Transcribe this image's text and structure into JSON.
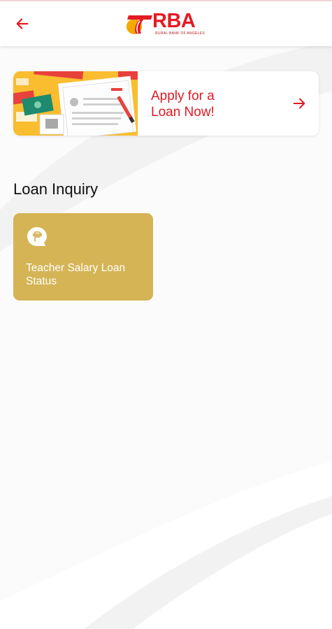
{
  "header": {
    "back_icon": "arrow-left-icon",
    "logo_text": "RBA",
    "logo_subtext": "RURAL BANK OF ANGELES",
    "accent_color": "#e31b23",
    "logo_mark_color": "#f5a800"
  },
  "apply_banner": {
    "line1": "Apply for a",
    "line2": "Loan Now!",
    "arrow_icon": "arrow-right-icon",
    "text_color": "#e01b24",
    "illustration_bg": "#f9bd2f"
  },
  "loan_inquiry": {
    "title": "Loan Inquiry",
    "tiles": [
      {
        "icon": "peso-chat-icon",
        "label_line1": "Teacher Salary Loan",
        "label_line2": "Status",
        "color": "#d4b455"
      }
    ]
  }
}
